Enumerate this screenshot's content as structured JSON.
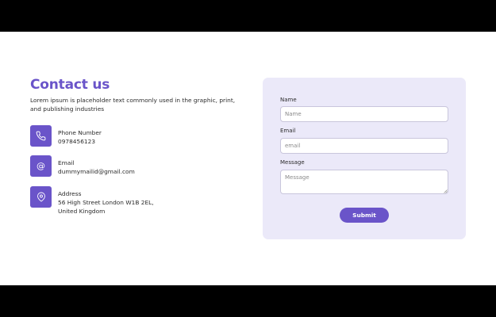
{
  "contact": {
    "title": "Contact us",
    "description": "Lorem ipsum is placeholder text commonly used in the graphic, print, and publishing industries",
    "phone": {
      "icon": "phone-icon",
      "label": "Phone Number",
      "value": "0978456123"
    },
    "email": {
      "icon": "at-icon",
      "label": "Email",
      "value": "dummymailid@gmail.com"
    },
    "address": {
      "icon": "location-pin-icon",
      "label": "Address",
      "line1": "56 High Street London W1B 2EL,",
      "line2": "United Kingdom"
    }
  },
  "form": {
    "name_label": "Name",
    "name_placeholder": "Name",
    "name_value": "",
    "email_label": "Email",
    "email_placeholder": "email",
    "email_value": "",
    "message_label": "Message",
    "message_placeholder": "Message",
    "message_value": "",
    "submit_label": "Submit"
  },
  "colors": {
    "accent": "#6a54c9",
    "card_background": "#ebe9f9",
    "page_background": "#ffffff"
  }
}
